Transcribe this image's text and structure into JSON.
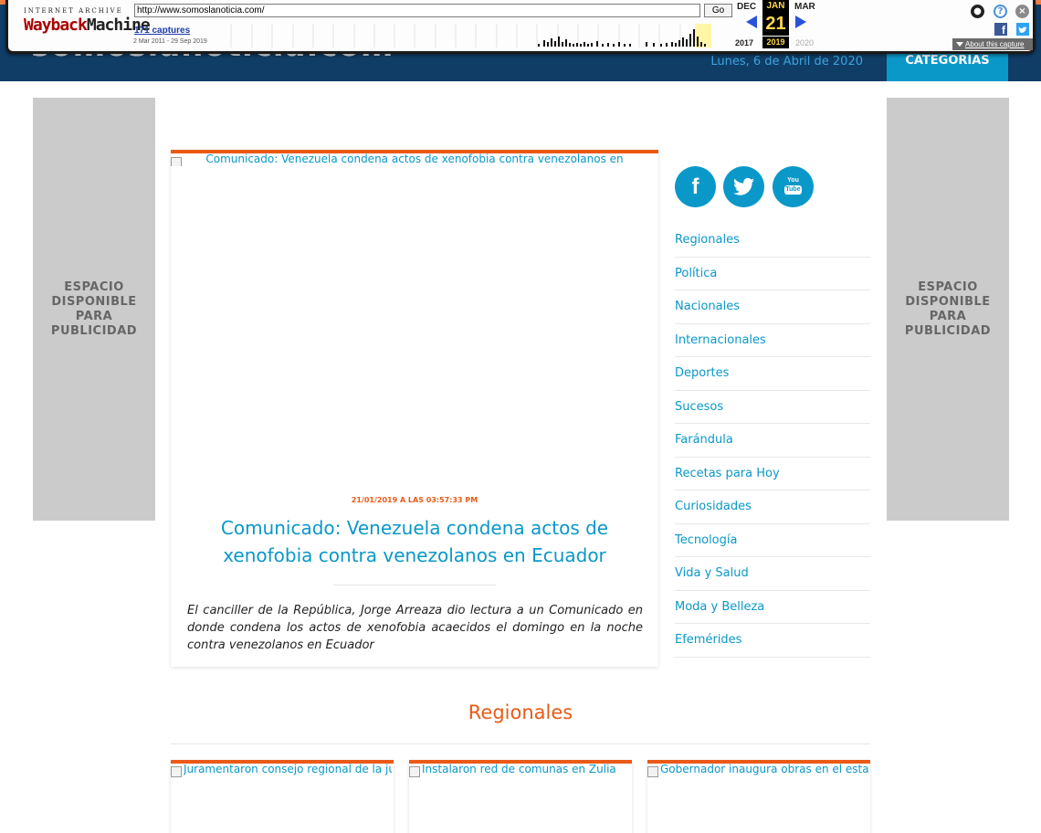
{
  "wayback": {
    "logo_small": "INTERNET ARCHIVE",
    "logo_word1": "Wayback",
    "logo_word2": "Machine",
    "url": "http://www.somoslanoticia.com/",
    "go_label": "Go",
    "captures": "171 captures",
    "range": "2 Mar 2011 - 29 Sep 2019",
    "month_prev": "DEC",
    "month_cur": "JAN",
    "month_next": "MAR",
    "day": "21",
    "year_prev": "2017",
    "year_cur": "2019",
    "year_next": "2020",
    "about": "About this capture"
  },
  "site": {
    "logo": "somoslanoticia.com",
    "date": "Lunes, 6 de Abril de 2020",
    "categories_button": "CATEGORÍAS"
  },
  "ads": {
    "left": "ESPACIO\nDISPONIBLE\nPARA\nPUBLICIDAD",
    "right": "ESPACIO\nDISPONIBLE\nPARA\nPUBLICIDAD"
  },
  "article": {
    "image_alt": "Comunicado: Venezuela condena actos de xenofobia contra venezolanos en",
    "meta": "21/01/2019 A LAS 03:57:33 PM",
    "title": "Comunicado: Venezuela condena actos de xenofobia contra venezolanos en Ecuador",
    "excerpt": "El canciller de la República, Jorge Arreaza dio lectura a un Comunicado en donde condena los actos de xenofobia acaecidos el domingo en la noche contra venezolanos en Ecuador"
  },
  "social": {
    "facebook": "f",
    "youtube_top": "You",
    "youtube_bottom": "Tube"
  },
  "categories": [
    "Regionales",
    "Política",
    "Nacionales",
    "Internacionales",
    "Deportes",
    "Sucesos",
    "Farándula",
    "Recetas para Hoy",
    "Curiosidades",
    "Tecnología",
    "Vida y Salud",
    "Moda y Belleza",
    "Efemérides"
  ],
  "regionales": {
    "title": "Regionales",
    "cards": [
      {
        "alt": "Juramentaron consejo regional de la juventud"
      },
      {
        "alt": "Instalaron red de comunas en Zulia"
      },
      {
        "alt": "Gobernador inaugura obras en el estado"
      }
    ]
  },
  "colors": {
    "accent": "#ea5a16",
    "link": "#0a98c9",
    "header": "#0f3d66"
  }
}
